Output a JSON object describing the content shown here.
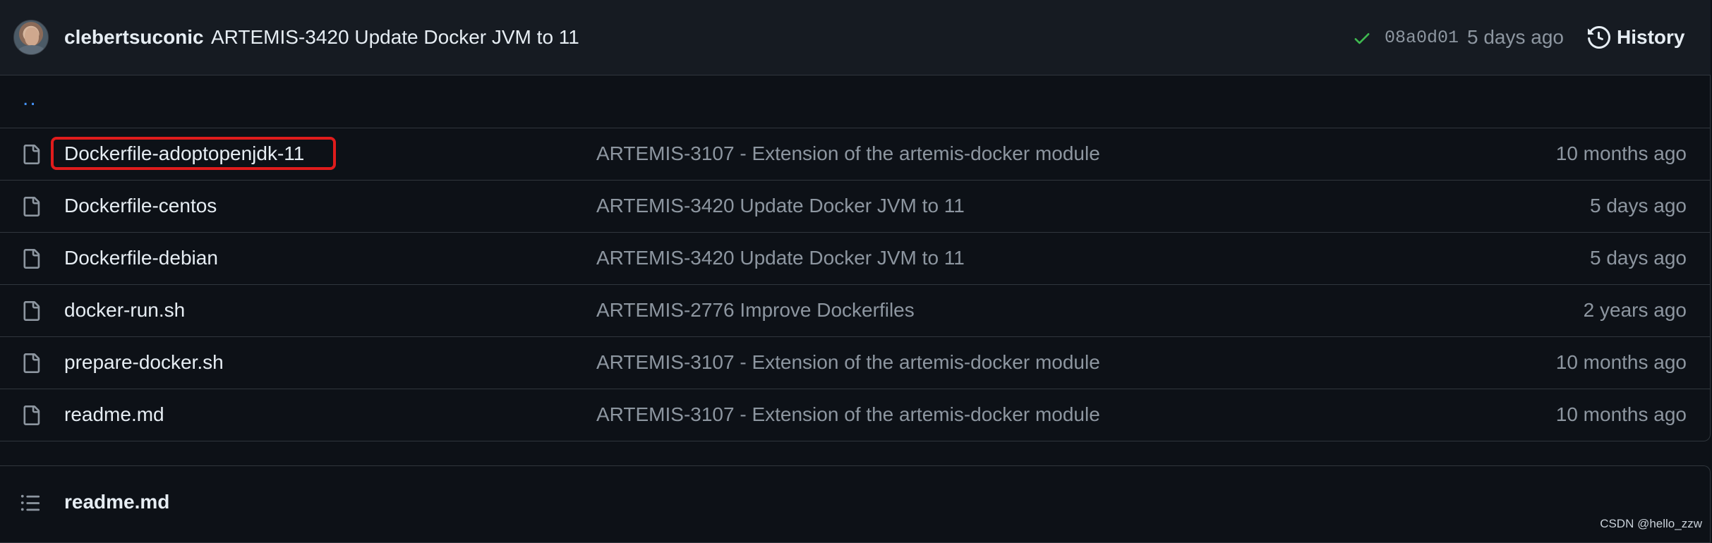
{
  "commit": {
    "author": "clebertsuconic",
    "message": "ARTEMIS-3420 Update Docker JVM to 11",
    "sha": "08a0d01",
    "time": "5 days ago",
    "history_label": "History"
  },
  "parent_link": "..",
  "files": [
    {
      "name": "Dockerfile-adoptopenjdk-11",
      "commit": "ARTEMIS-3107 - Extension of the artemis-docker module",
      "age": "10 months ago",
      "icon": "file-icon"
    },
    {
      "name": "Dockerfile-centos",
      "commit": "ARTEMIS-3420 Update Docker JVM to 11",
      "age": "5 days ago",
      "icon": "file-icon"
    },
    {
      "name": "Dockerfile-debian",
      "commit": "ARTEMIS-3420 Update Docker JVM to 11",
      "age": "5 days ago",
      "icon": "file-icon"
    },
    {
      "name": "docker-run.sh",
      "commit": "ARTEMIS-2776 Improve Dockerfiles",
      "age": "2 years ago",
      "icon": "file-icon"
    },
    {
      "name": "prepare-docker.sh",
      "commit": "ARTEMIS-3107 - Extension of the artemis-docker module",
      "age": "10 months ago",
      "icon": "file-icon"
    },
    {
      "name": "readme.md",
      "commit": "ARTEMIS-3107 - Extension of the artemis-docker module",
      "age": "10 months ago",
      "icon": "file-icon"
    }
  ],
  "readme": {
    "title": "readme.md",
    "icon": "list-icon"
  },
  "watermark": "CSDN @hello_zzw",
  "colors": {
    "background": "#0d1117",
    "header_background": "#161b22",
    "border": "#30363d",
    "link": "#4493f8",
    "muted": "#8d96a0",
    "success": "#3fb950",
    "highlight": "#e01c1c"
  }
}
